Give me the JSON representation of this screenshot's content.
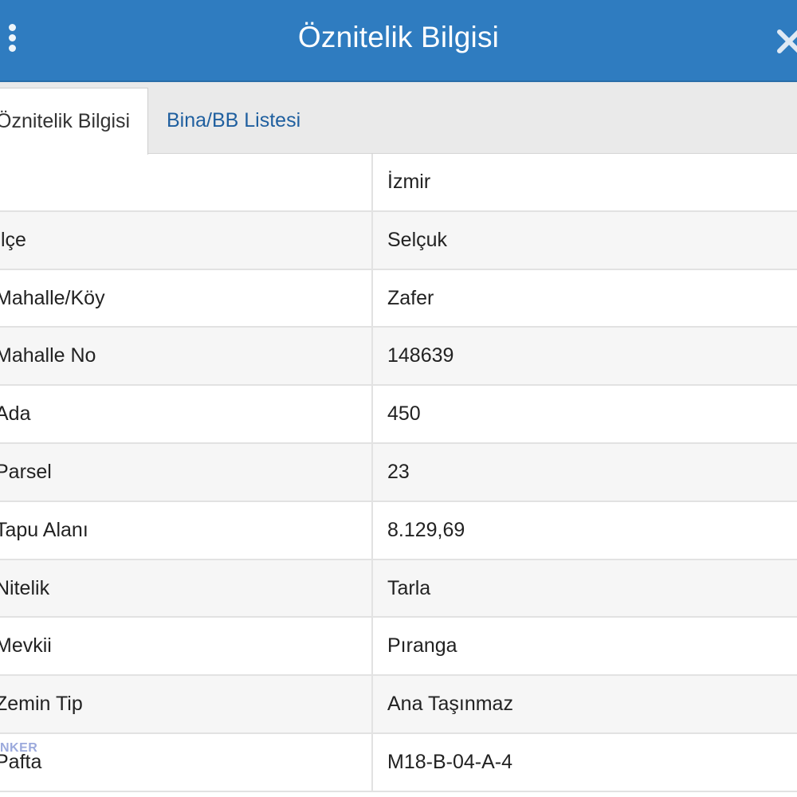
{
  "window": {
    "title": "Öznitelik Bilgisi"
  },
  "tabs": [
    {
      "label": "Öznitelik Bilgisi",
      "active": true
    },
    {
      "label": "Bina/BB Listesi",
      "active": false
    }
  ],
  "rows": [
    {
      "label": "",
      "value": "İzmir"
    },
    {
      "label": "İlçe",
      "value": "Selçuk"
    },
    {
      "label": "Mahalle/Köy",
      "value": "Zafer"
    },
    {
      "label": "Mahalle No",
      "value": "148639"
    },
    {
      "label": "Ada",
      "value": "450"
    },
    {
      "label": "Parsel",
      "value": "23"
    },
    {
      "label": "Tapu Alanı",
      "value": "8.129,69"
    },
    {
      "label": "Nitelik",
      "value": "Tarla"
    },
    {
      "label": "Mevkii",
      "value": "Pıranga"
    },
    {
      "label": "Zemin Tip",
      "value": "Ana Taşınmaz"
    },
    {
      "label": "Pafta",
      "value": "M18-B-04-A-4"
    }
  ],
  "watermark": "NKER",
  "icons": {
    "menu": "more-vertical-icon",
    "close": "close-icon"
  },
  "colors": {
    "header": "#2f7cc0",
    "tab_active_text": "#333333",
    "tab_inactive_text": "#1f5f9f"
  }
}
